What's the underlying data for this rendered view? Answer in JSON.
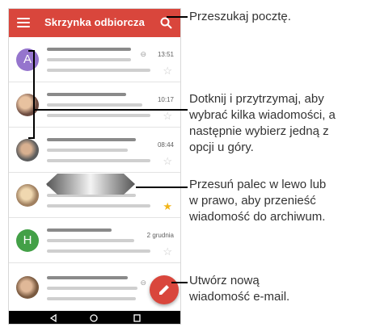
{
  "app_bar": {
    "title": "Skrzynka odbiorcza",
    "menu_icon": "menu-icon",
    "search_icon": "search-icon",
    "color": "#d9463c"
  },
  "messages": [
    {
      "avatar_letter": "A",
      "avatar_color": "#9575cd",
      "time": "13:51",
      "attachment": true,
      "starred": false
    },
    {
      "avatar_letter": "",
      "avatar_color": "#6d4c41",
      "time": "10:17",
      "attachment": false,
      "starred": false
    },
    {
      "avatar_letter": "",
      "avatar_color": "#5d5d5d",
      "time": "08:44",
      "attachment": false,
      "starred": false
    },
    {
      "avatar_letter": "",
      "avatar_color": "#a08060",
      "time": "",
      "attachment": false,
      "starred": true
    },
    {
      "avatar_letter": "H",
      "avatar_color": "#43a047",
      "time": "2 grudnia",
      "attachment": false,
      "starred": false
    },
    {
      "avatar_letter": "",
      "avatar_color": "#7a5a40",
      "time": "",
      "attachment": true,
      "starred": false
    }
  ],
  "callouts": {
    "search": "Przeszukaj pocztę.",
    "select": [
      "Dotknij i przytrzymaj, aby",
      "wybrać kilka wiadomości, a",
      "następnie wybierz jedną z",
      "opcji u góry."
    ],
    "swipe": [
      "Przesuń palec w lewo lub",
      "w prawo, aby przenieść",
      "wiadomość do archiwum."
    ],
    "compose": [
      "Utwórz nową",
      "wiadomość e-mail."
    ]
  },
  "nav_bar": {
    "back_icon": "back-icon",
    "home_icon": "home-icon",
    "recents_icon": "recents-icon"
  }
}
